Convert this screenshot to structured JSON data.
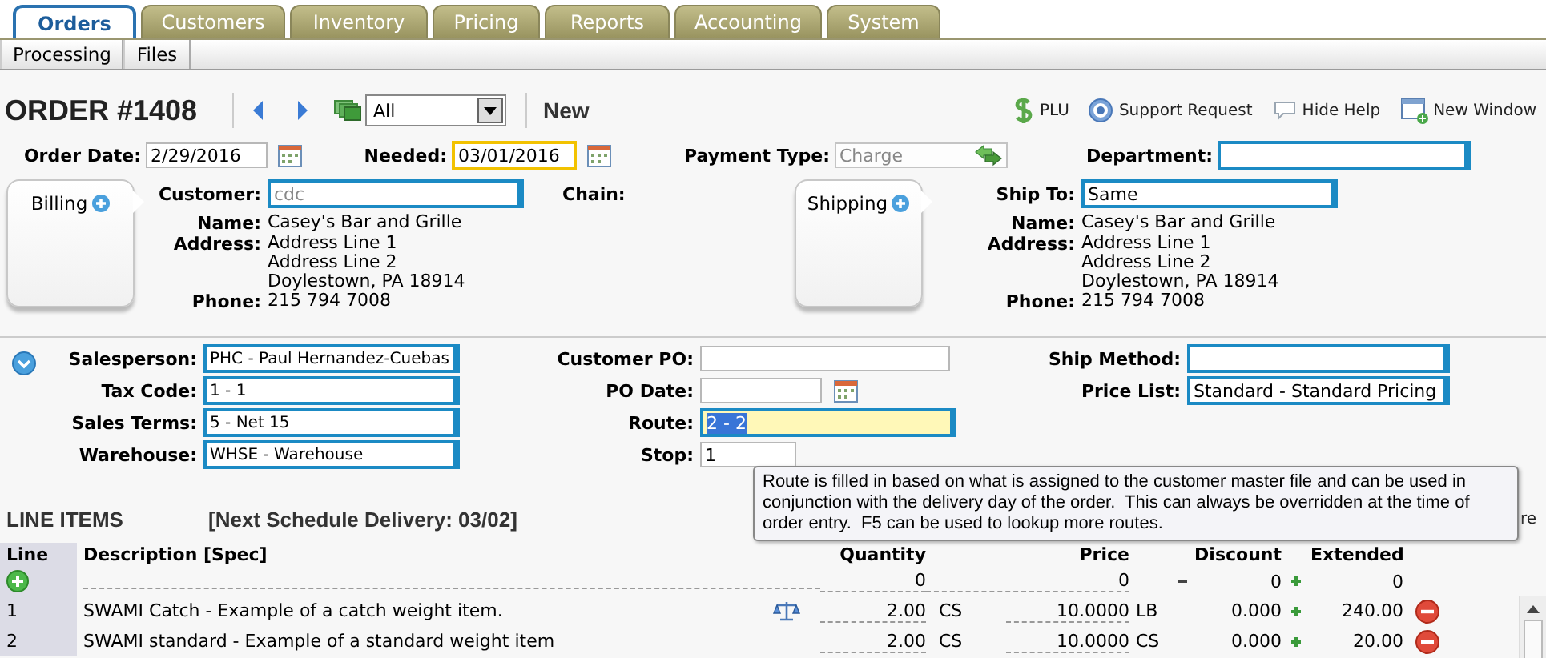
{
  "tabs": [
    {
      "label": "Orders",
      "selected": true
    },
    {
      "label": "Customers",
      "selected": false
    },
    {
      "label": "Inventory",
      "selected": false
    },
    {
      "label": "Pricing",
      "selected": false
    },
    {
      "label": "Reports",
      "selected": false
    },
    {
      "label": "Accounting",
      "selected": false
    },
    {
      "label": "System",
      "selected": false
    }
  ],
  "subtabs": [
    "Processing",
    "Files"
  ],
  "order": {
    "title": "ORDER #1408",
    "filter": "All",
    "status": "New"
  },
  "toolbar": [
    {
      "kind": "dollar",
      "label": "PLU"
    },
    {
      "kind": "help",
      "label": "Support Request"
    },
    {
      "kind": "bubble",
      "label": "Hide Help"
    },
    {
      "kind": "window",
      "label": "New Window"
    }
  ],
  "header_fields": [
    {
      "label": "Order Date:",
      "kind": "date",
      "value": "2/29/2016",
      "focused": false,
      "disabled": false
    },
    {
      "label": "Needed:",
      "kind": "date",
      "value": "03/01/2016",
      "focused": true,
      "disabled": false
    },
    {
      "label": "Payment Type:",
      "kind": "swap",
      "value": "Charge",
      "focused": false,
      "disabled": true
    },
    {
      "label": "Department:",
      "kind": "lookup",
      "focused": false,
      "disabled": false
    }
  ],
  "billing": {
    "card": "Billing",
    "field": {
      "label": "Customer:",
      "placeholder": "cdc"
    },
    "chain_label": "Chain:",
    "details": [
      {
        "label": "Name:",
        "lines": [
          "Casey's Bar and Grille"
        ]
      },
      {
        "label": "Address:",
        "lines": [
          "Address Line 1",
          "Address Line 2",
          "Doylestown, PA 18914"
        ]
      },
      {
        "label": "Phone:",
        "lines": [
          "215 794 7008"
        ]
      }
    ]
  },
  "shipping": {
    "card": "Shipping",
    "field": {
      "label": "Ship To:",
      "value": "Same"
    },
    "details": [
      {
        "label": "Name:",
        "lines": [
          "Casey's Bar and Grille"
        ]
      },
      {
        "label": "Address:",
        "lines": [
          "Address Line 1",
          "Address Line 2",
          "Doylestown, PA 18914"
        ]
      },
      {
        "label": "Phone:",
        "lines": [
          "215 794 7008"
        ]
      }
    ]
  },
  "order_fields": [
    [
      {
        "label": "Salesperson:",
        "kind": "lookup",
        "value": "PHC - Paul Hernandez-Cuebas",
        "highlighted": false
      },
      {
        "label": "Tax Code:",
        "kind": "lookup",
        "value": "1 - 1",
        "highlighted": false
      },
      {
        "label": "Sales Terms:",
        "kind": "lookup",
        "value": "5 - Net 15",
        "highlighted": false
      },
      {
        "label": "Warehouse:",
        "kind": "lookup",
        "value": "WHSE - Warehouse",
        "highlighted": false
      }
    ],
    [
      {
        "label": "Customer PO:",
        "kind": "text",
        "highlighted": false
      },
      {
        "label": "PO Date:",
        "kind": "date",
        "highlighted": false
      },
      {
        "label": "Route:",
        "kind": "lookup",
        "value": "2 - 2",
        "highlighted": true
      },
      {
        "label": "Stop:",
        "kind": "short",
        "value": "1",
        "highlighted": false
      }
    ],
    [
      {
        "label": "Ship Method:",
        "kind": "lookup",
        "highlighted": false
      },
      {
        "label": "Price List:",
        "kind": "lookup",
        "value": "Standard - Standard Pricing",
        "highlighted": false
      }
    ]
  ],
  "tooltip": "Route is filled in based on what is assigned to the customer master file and can be used in conjunction with the delivery day of the order.  This can always be overridden at the time of order entry.  F5 can be used to lookup more routes.",
  "line_items": {
    "title": "LINE ITEMS",
    "delivery": "[Next Schedule Delivery: 03/02]",
    "link": "re",
    "columns": [
      "Line",
      "Description [Spec]",
      "Quantity",
      "Price",
      "Discount",
      "Extended"
    ],
    "entry": {
      "quantity": "0",
      "price": "0",
      "discount": "0",
      "extended": "0"
    },
    "rows": [
      {
        "line": "1",
        "description": "SWAMI Catch - Example of a catch weight item.",
        "catch_weight": true,
        "quantity": "2.00",
        "unit": "CS",
        "price": "10.0000",
        "price_unit": "LB",
        "discount": "0.000",
        "extended": "240.00"
      },
      {
        "line": "2",
        "description": "SWAMI standard - Example of a standard weight item",
        "catch_weight": false,
        "quantity": "2.00",
        "unit": "CS",
        "price": "10.0000",
        "price_unit": "CS",
        "discount": "0.000",
        "extended": "20.00"
      }
    ]
  }
}
